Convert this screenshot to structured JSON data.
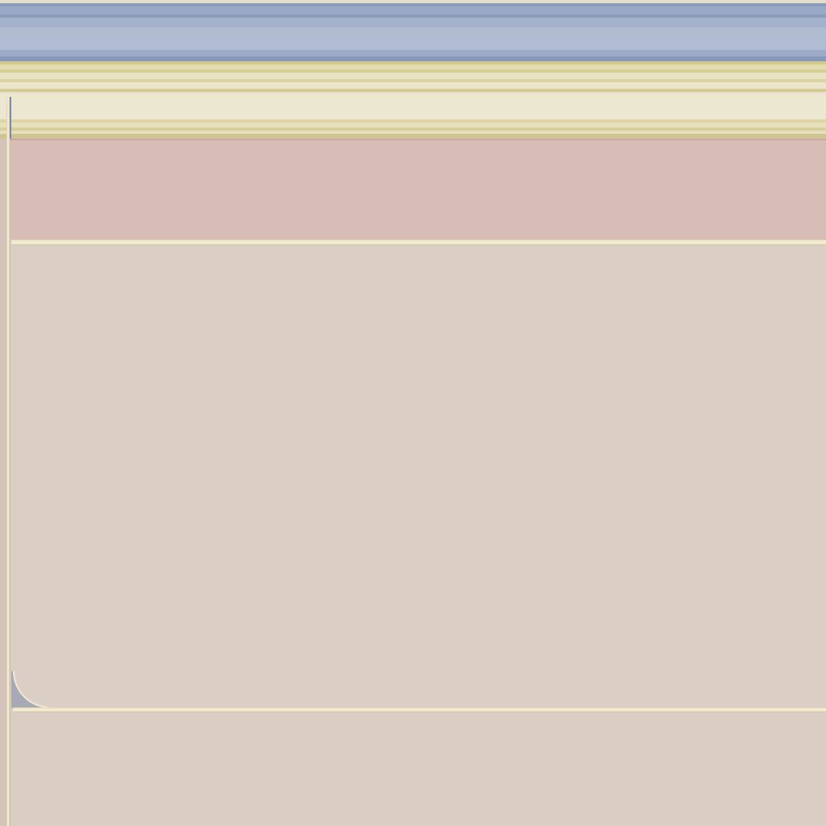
{
  "colors": {
    "blue_band": "#b0bcd2",
    "yellow_band": "#ece7d1",
    "pink_band": "#d8bdb7",
    "panel": "#dbcec4",
    "rule": "#f2ead0",
    "notch": "#a7aab5"
  }
}
